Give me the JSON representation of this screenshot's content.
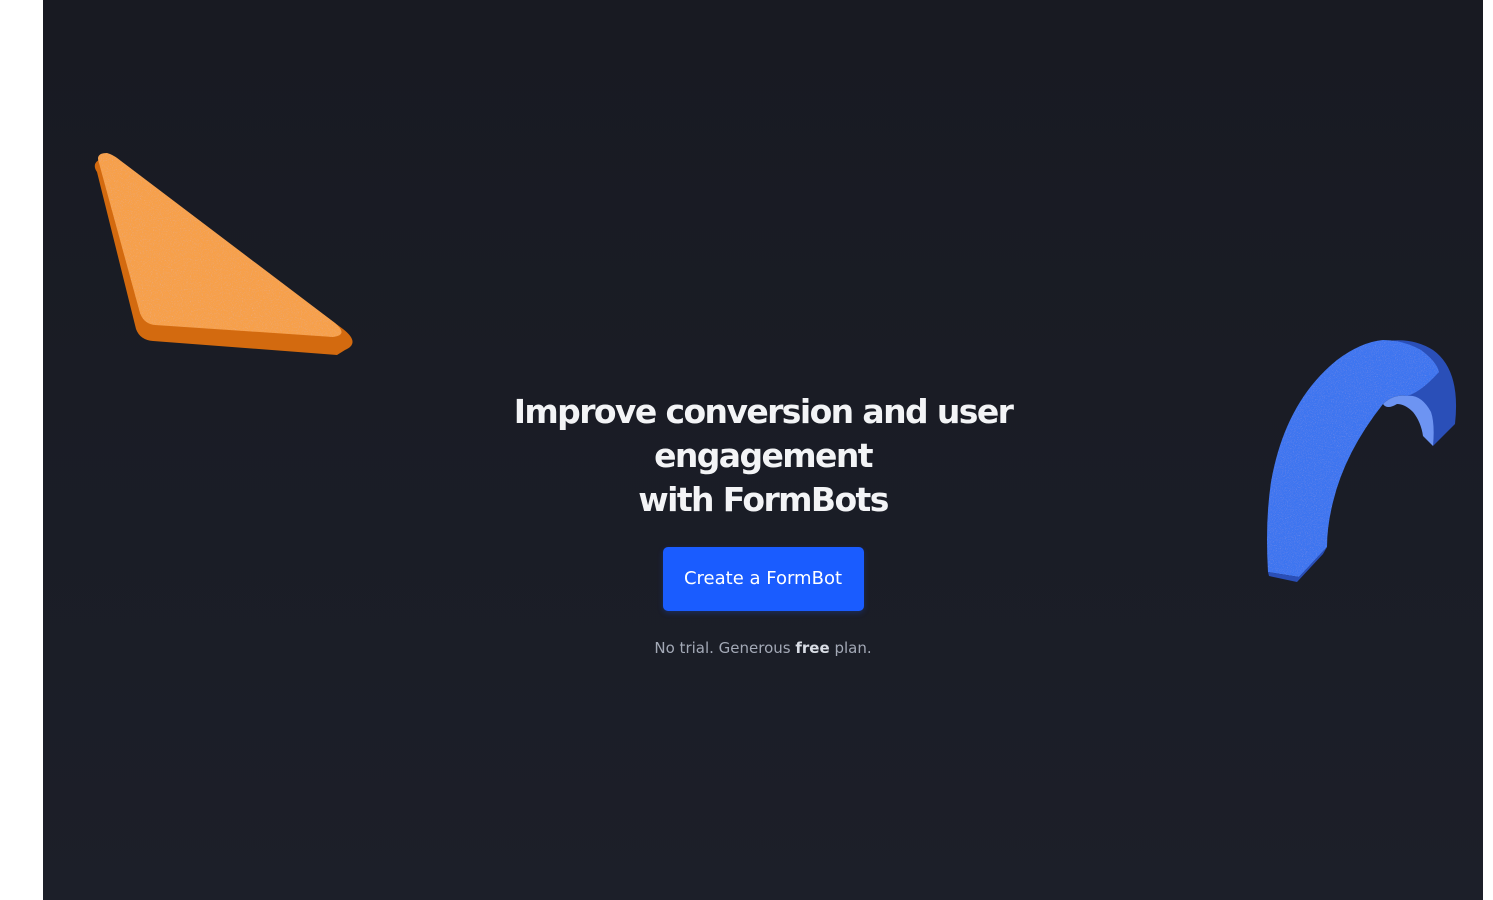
{
  "hero": {
    "headline_line1": "Improve conversion and user engagement",
    "headline_line2": "with FormBots",
    "cta_label": "Create a FormBot",
    "sub_prefix": "No trial. Generous",
    "sub_emphasis": "free",
    "sub_suffix": "plan."
  },
  "decorations": {
    "left_shape": "orange-triangle",
    "right_shape": "blue-arch"
  },
  "colors": {
    "background": "#1a1d26",
    "accent": "#1a5cff",
    "triangle": "#f5993b",
    "arch": "#3b6fe6"
  }
}
